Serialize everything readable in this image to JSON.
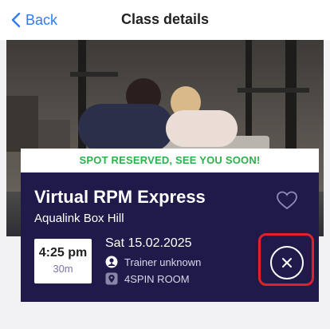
{
  "nav": {
    "back_label": "Back",
    "title": "Class details"
  },
  "banner": {
    "text": "SPOT RESERVED, SEE YOU SOON!",
    "color": "#2bb24a"
  },
  "class": {
    "title": "Virtual RPM Express",
    "venue": "Aqualink Box Hill",
    "time": "4:25 pm",
    "duration": "30m",
    "date": "Sat 15.02.2025",
    "trainer": "Trainer unknown",
    "room": "4SPIN ROOM"
  },
  "colors": {
    "accent": "#2f7bf6",
    "card": "#1f1a49",
    "highlight": "#e0202a"
  },
  "icons": [
    "chevron-left-icon",
    "heart-icon",
    "trainer-icon",
    "location-pin-icon",
    "close-icon"
  ]
}
